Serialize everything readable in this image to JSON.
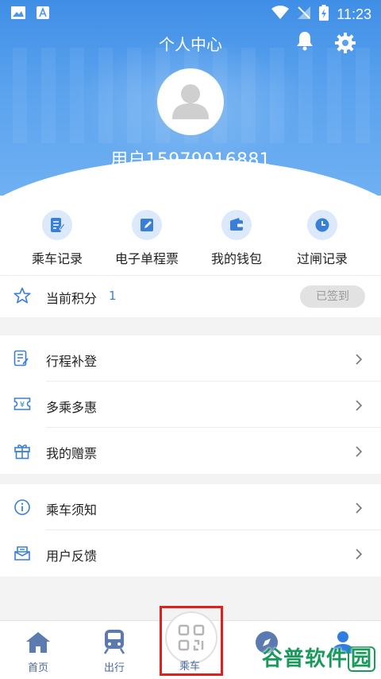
{
  "status_bar": {
    "time": "11:23"
  },
  "header": {
    "title": "个人中心",
    "username": "用户15979016881"
  },
  "quick_actions": [
    {
      "label": "乘车记录",
      "icon": "ride-record-icon"
    },
    {
      "label": "电子单程票",
      "icon": "e-ticket-icon"
    },
    {
      "label": "我的钱包",
      "icon": "wallet-icon"
    },
    {
      "label": "过闸记录",
      "icon": "clock-icon"
    }
  ],
  "points": {
    "label": "当前积分",
    "value": "1",
    "sign_label": "已签到"
  },
  "menu_group_1": [
    {
      "label": "行程补登",
      "icon": "edit-document-icon"
    },
    {
      "label": "多乘多惠",
      "icon": "coupon-yen-icon"
    },
    {
      "label": "我的赠票",
      "icon": "gift-icon"
    }
  ],
  "menu_group_2": [
    {
      "label": "乘车须知",
      "icon": "info-icon"
    },
    {
      "label": "用户反馈",
      "icon": "feedback-mail-icon"
    }
  ],
  "bottom_nav": {
    "home": "首页",
    "trip": "出行",
    "ride": "乘车"
  },
  "watermark": {
    "text": "谷普软件",
    "last": "园"
  },
  "colors": {
    "accent": "#3a7fd6",
    "header": "#4a96ea",
    "highlight": "#e02020"
  }
}
